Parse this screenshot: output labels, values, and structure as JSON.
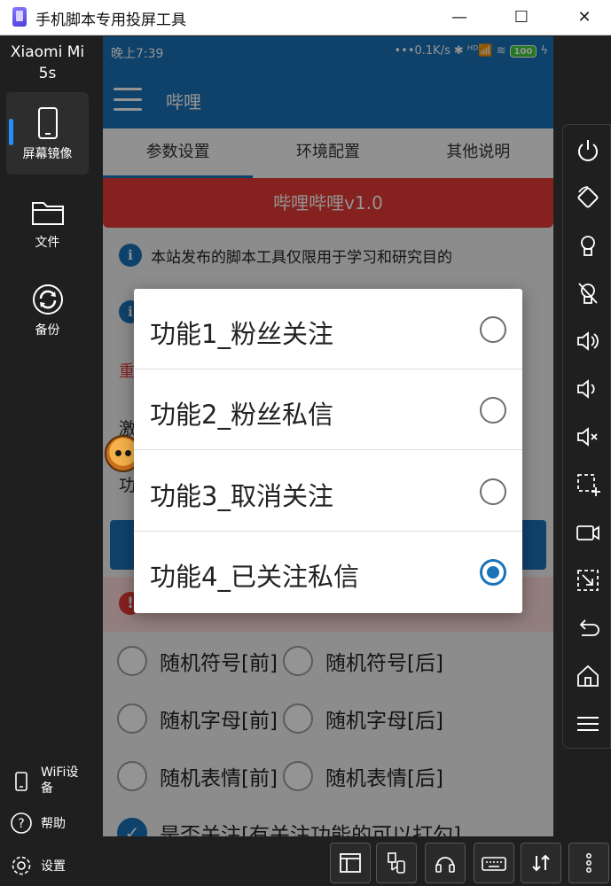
{
  "window": {
    "title": "手机脚本专用投屏工具",
    "controls": [
      "—",
      "☐",
      "✕"
    ]
  },
  "sidebar": {
    "device_name": "Xiaomi Mi 5s",
    "items": [
      {
        "label": "屏幕镜像",
        "icon": "phone-icon",
        "active": true
      },
      {
        "label": "文件",
        "icon": "folder-icon",
        "active": false
      },
      {
        "label": "备份",
        "icon": "sync-icon",
        "active": false
      }
    ],
    "bottom": [
      {
        "label": "WiFi设备",
        "icon": "wifi-device-icon"
      },
      {
        "label": "帮助",
        "icon": "help-icon"
      },
      {
        "label": "设置",
        "icon": "gear-icon"
      }
    ]
  },
  "phone": {
    "status": {
      "time": "晚上7:39",
      "net": "•••0.1K/s",
      "icons": "✱ ᴴᴰ📶 ≋",
      "battery": "100",
      "charge": "ϟ"
    },
    "appbar": {
      "title": "哔哩"
    },
    "tabs": [
      "参数设置",
      "环境配置",
      "其他说明"
    ],
    "banner": "哔哩哔哩v1.0",
    "info1": "本站发布的脚本工具仅限用于学习和研究目的",
    "info_icon": "i",
    "partial": {
      "red_left": "重",
      "red_right": "!",
      "row1": "激",
      "row2": "功"
    },
    "warn_icon": "!",
    "checks": [
      {
        "label": "随机符号[前]",
        "checked": false
      },
      {
        "label": "随机符号[后]",
        "checked": false
      },
      {
        "label": "随机字母[前]",
        "checked": false
      },
      {
        "label": "随机字母[后]",
        "checked": false
      },
      {
        "label": "随机表情[前]",
        "checked": false
      },
      {
        "label": "随机表情[后]",
        "checked": false
      },
      {
        "label": "是否关注[有关注功能的可以打勾]",
        "checked": true
      }
    ]
  },
  "dialog": {
    "options": [
      {
        "label": "功能1_粉丝关注",
        "selected": false
      },
      {
        "label": "功能2_粉丝私信",
        "selected": false
      },
      {
        "label": "功能3_取消关注",
        "selected": false
      },
      {
        "label": "功能4_已关注私信",
        "selected": true
      }
    ]
  },
  "right_tools": [
    "power-icon",
    "rotate-icon",
    "bulb-icon",
    "bulb-off-icon",
    "volume-up-icon",
    "volume-down-icon",
    "mute-icon",
    "screenshot-icon",
    "record-icon",
    "crop-icon",
    "back-icon",
    "home-icon",
    "menu-icon"
  ],
  "bottom_tools": [
    "window-icon",
    "usb-icon",
    "headset-icon",
    "keyboard-icon",
    "transfer-icon",
    "more-icon"
  ],
  "colors": {
    "accent": "#1a73b8",
    "banner": "#e53935",
    "sidebar": "#1f1f1f"
  }
}
